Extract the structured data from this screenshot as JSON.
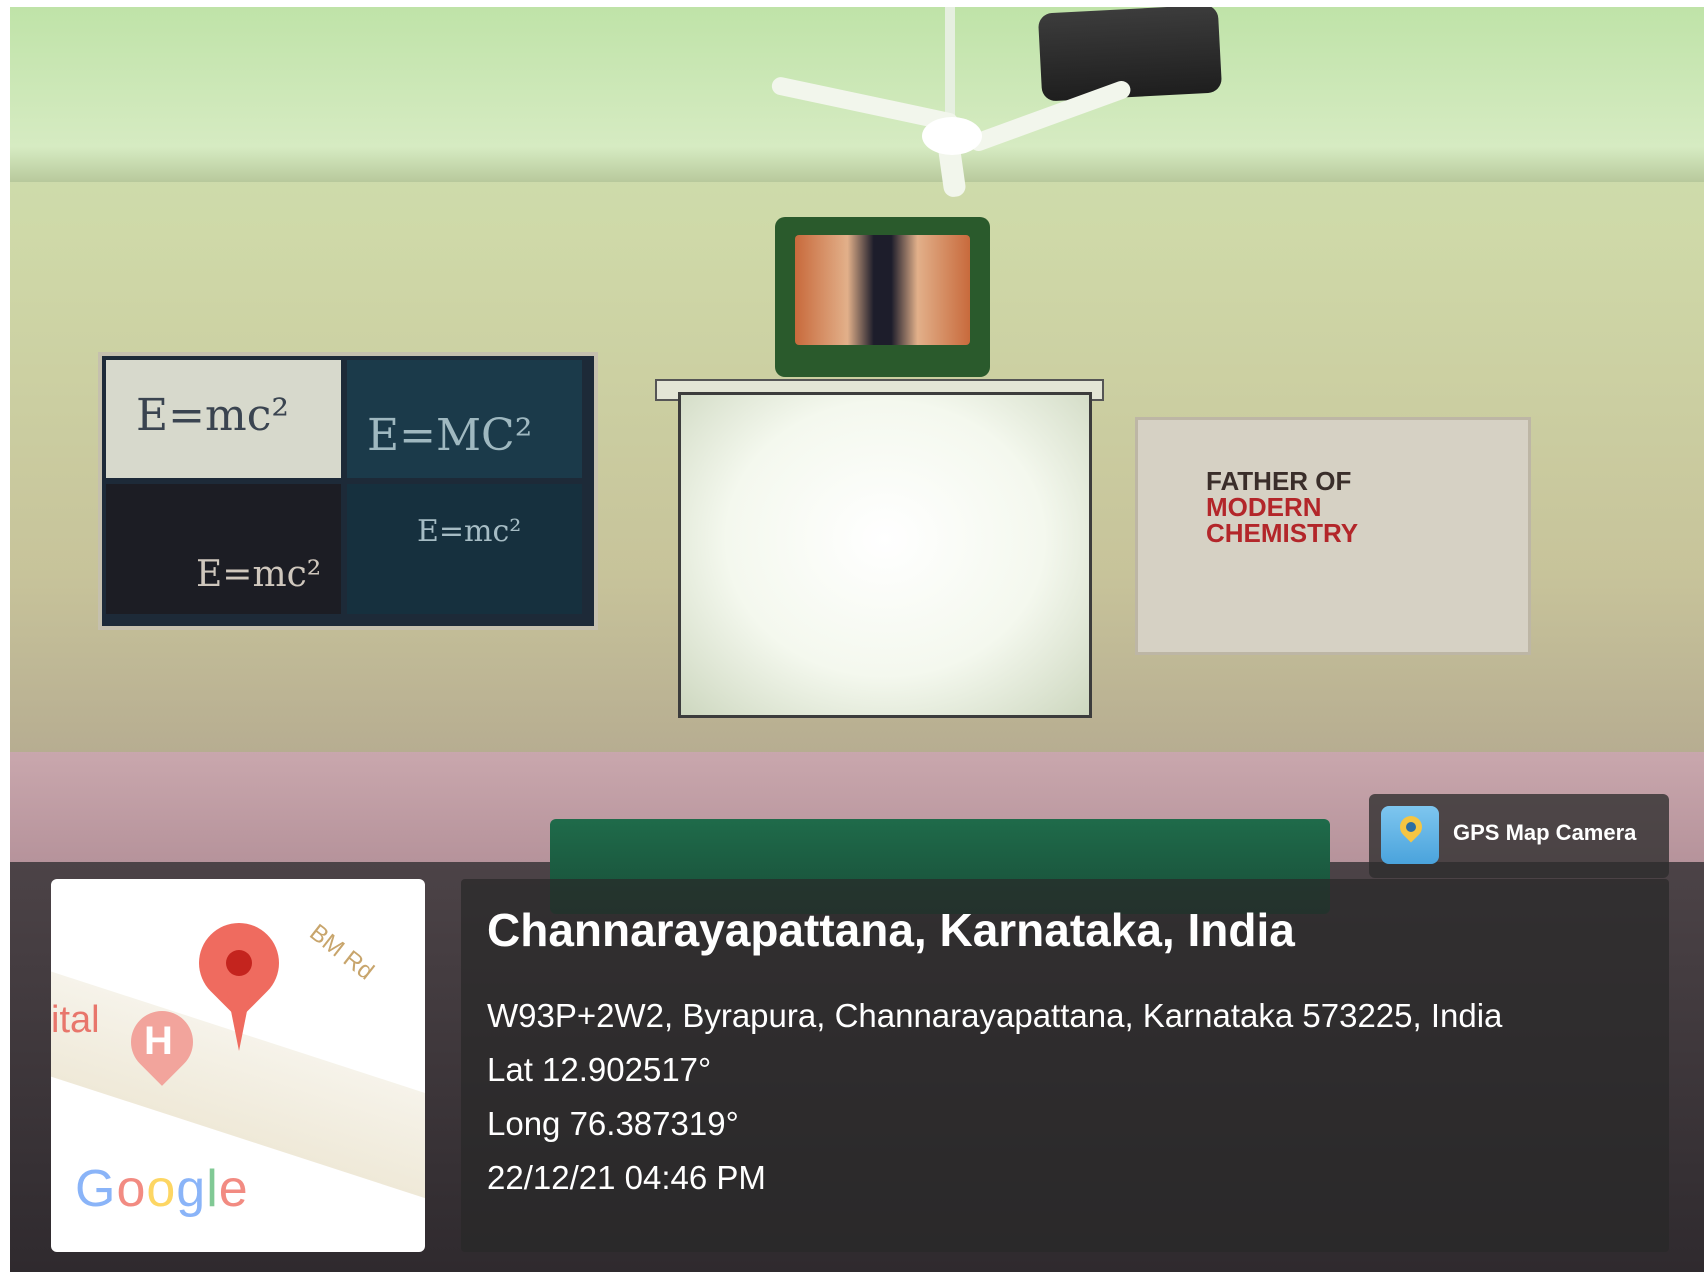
{
  "photo": {
    "posters": {
      "left_equations": [
        "E=mc²",
        "E=MC²",
        "E=mc²",
        "E=mc²"
      ],
      "right_title": {
        "line1": "FATHER OF",
        "line2": "MODERN",
        "line3": "CHEMISTRY"
      }
    }
  },
  "map": {
    "hospital_label": "ital",
    "hospital_marker": "H",
    "road_label": "BM Rd",
    "logo": [
      "G",
      "o",
      "o",
      "g",
      "l",
      "e"
    ],
    "pin_color": "#ef6b5f"
  },
  "badge": {
    "icon": "map-pin-icon",
    "label": "GPS Map Camera"
  },
  "location": {
    "title": "Channarayapattana, Karnataka, India",
    "address": "W93P+2W2, Byrapura, Channarayapattana, Karnataka 573225, India",
    "lat": "Lat 12.902517°",
    "long": "Long 76.387319°",
    "datetime": "22/12/21 04:46 PM"
  }
}
